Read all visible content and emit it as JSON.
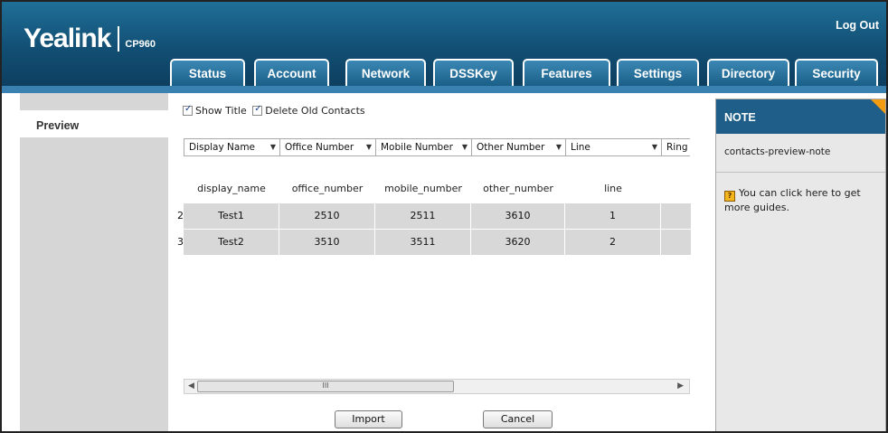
{
  "header": {
    "logo_text": "Yealink",
    "model": "CP960",
    "logout_label": "Log Out",
    "tabs": [
      {
        "label": "Status"
      },
      {
        "label": "Account"
      },
      {
        "label": "Network"
      },
      {
        "label": "DSSKey"
      },
      {
        "label": "Features"
      },
      {
        "label": "Settings"
      },
      {
        "label": "Directory"
      },
      {
        "label": "Security"
      }
    ]
  },
  "sidebar": {
    "active_item": "Preview"
  },
  "options": {
    "show_title": {
      "label": "Show Title",
      "checked": true
    },
    "delete_old": {
      "label": "Delete Old Contacts",
      "checked": true
    }
  },
  "selectors": [
    {
      "value": "Display Name"
    },
    {
      "value": "Office Number"
    },
    {
      "value": "Mobile Number"
    },
    {
      "value": "Other Number"
    },
    {
      "value": "Line"
    },
    {
      "value": "Ring"
    }
  ],
  "table": {
    "headers": [
      "display_name",
      "office_number",
      "mobile_number",
      "other_number",
      "line"
    ],
    "rows": [
      {
        "num": "2",
        "cells": [
          "Test1",
          "2510",
          "2511",
          "3610",
          "1"
        ]
      },
      {
        "num": "3",
        "cells": [
          "Test2",
          "3510",
          "3511",
          "3620",
          "2"
        ]
      }
    ]
  },
  "scrollbar": {
    "thumb_glyph": "III"
  },
  "buttons": {
    "import_label": "Import",
    "cancel_label": "Cancel"
  },
  "note": {
    "title": "NOTE",
    "text": "contacts-preview-note",
    "guide_text": "You can click here to get more guides."
  },
  "colors": {
    "header_blue": "#124f74",
    "tab_blue": "#2a7aa8",
    "note_accent": "#f39c12"
  }
}
